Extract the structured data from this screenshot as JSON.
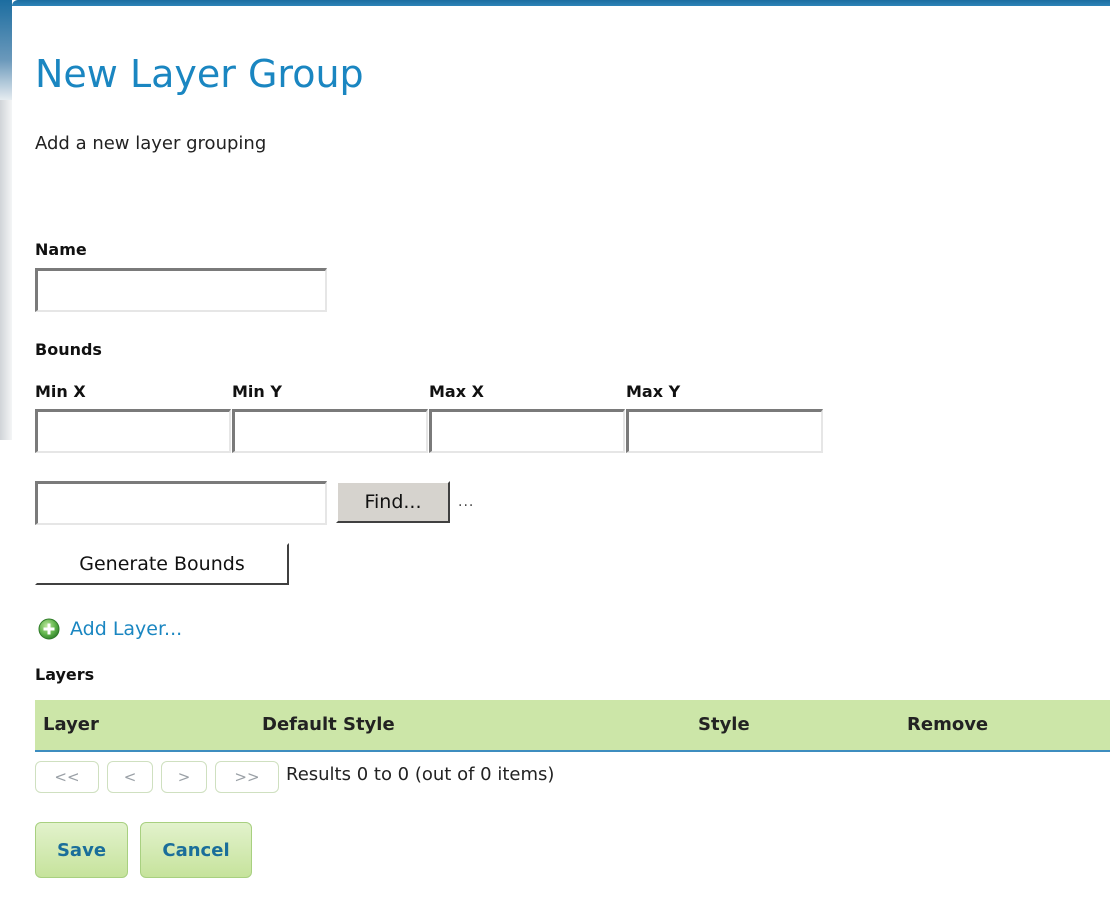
{
  "page": {
    "title": "New Layer Group",
    "description": "Add a new layer grouping"
  },
  "form": {
    "name_label": "Name",
    "name_value": "",
    "bounds_label": "Bounds",
    "min_x_label": "Min X",
    "min_y_label": "Min Y",
    "max_x_label": "Max X",
    "max_y_label": "Max Y",
    "min_x_value": "",
    "min_y_value": "",
    "max_x_value": "",
    "max_y_value": "",
    "crs_value": "",
    "find_label": "Find...",
    "crs_ellipsis": "...",
    "generate_bounds_label": "Generate Bounds"
  },
  "layers": {
    "add_label": "Add Layer...",
    "section_label": "Layers",
    "columns": [
      "Layer",
      "Default Style",
      "Style",
      "Remove"
    ],
    "rows": [],
    "pager": {
      "first": "<<",
      "prev": "<",
      "next": ">",
      "last": ">>",
      "results_text": "Results 0 to 0 (out of 0 items)"
    }
  },
  "actions": {
    "save_label": "Save",
    "cancel_label": "Cancel"
  },
  "colors": {
    "title": "#1a86c1",
    "header_bg": "#cce6a8",
    "link": "#1a86c1",
    "button_text": "#1a6e9a"
  },
  "icons": {
    "add": "add-circle-icon"
  }
}
